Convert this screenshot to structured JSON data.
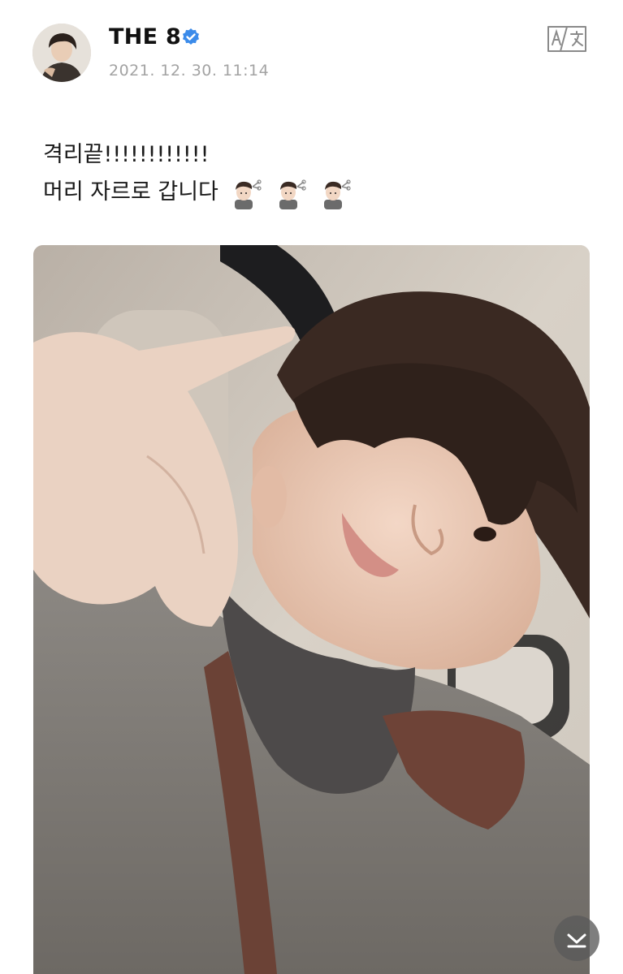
{
  "post": {
    "author": {
      "name": "THE 8",
      "verified": true,
      "avatar_icon": "user-avatar"
    },
    "timestamp": "2021. 12. 30. 11:14",
    "translate_icon": "translate-icon",
    "text_line1": "격리끝!!!!!!!!!!!!",
    "text_line2": "머리 자르로 갑니다",
    "emojis": [
      "man-getting-haircut",
      "man-getting-haircut",
      "man-getting-haircut"
    ],
    "photo": {
      "description_icon": "selfie-photo"
    }
  },
  "scroll_button_icon": "chevron-down-icon",
  "colors": {
    "verified_blue": "#3b8bea",
    "timestamp_gray": "#a3a3a3",
    "text": "#1a1a1a"
  }
}
